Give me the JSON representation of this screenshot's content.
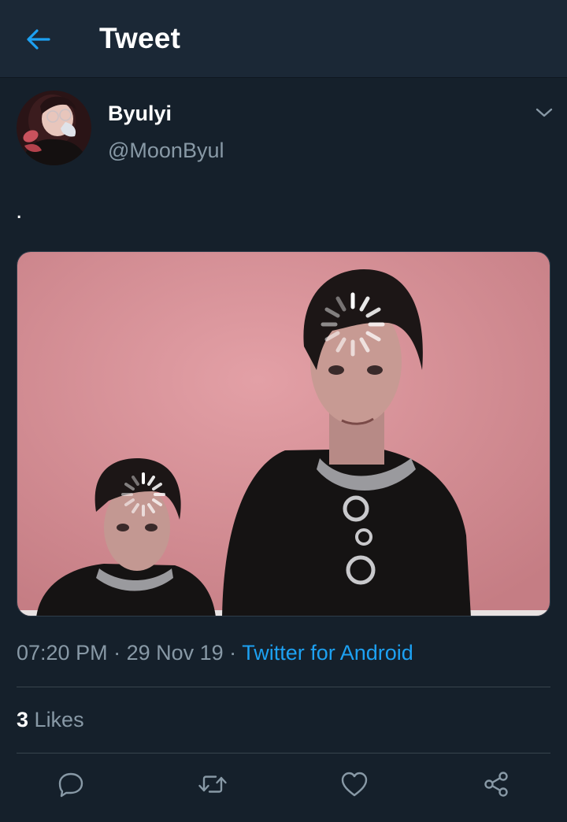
{
  "header": {
    "title": "Tweet",
    "back_icon": "arrow-left-icon"
  },
  "author": {
    "display_name": "Byulyi",
    "handle": "@MoonByul"
  },
  "tweet": {
    "text": ".",
    "time": "07:20 PM",
    "date": "29 Nov 19",
    "source": "Twitter for Android",
    "separator": " · "
  },
  "stats": {
    "likes_count": "3",
    "likes_label": "Likes"
  },
  "actions": [
    {
      "icon": "reply-icon"
    },
    {
      "icon": "retweet-icon"
    },
    {
      "icon": "like-icon"
    },
    {
      "icon": "share-icon"
    }
  ],
  "colors": {
    "background": "#15202b",
    "header": "#1b2836",
    "accent": "#1da1f2",
    "secondary_text": "#8899a6",
    "divider": "#38444d"
  }
}
